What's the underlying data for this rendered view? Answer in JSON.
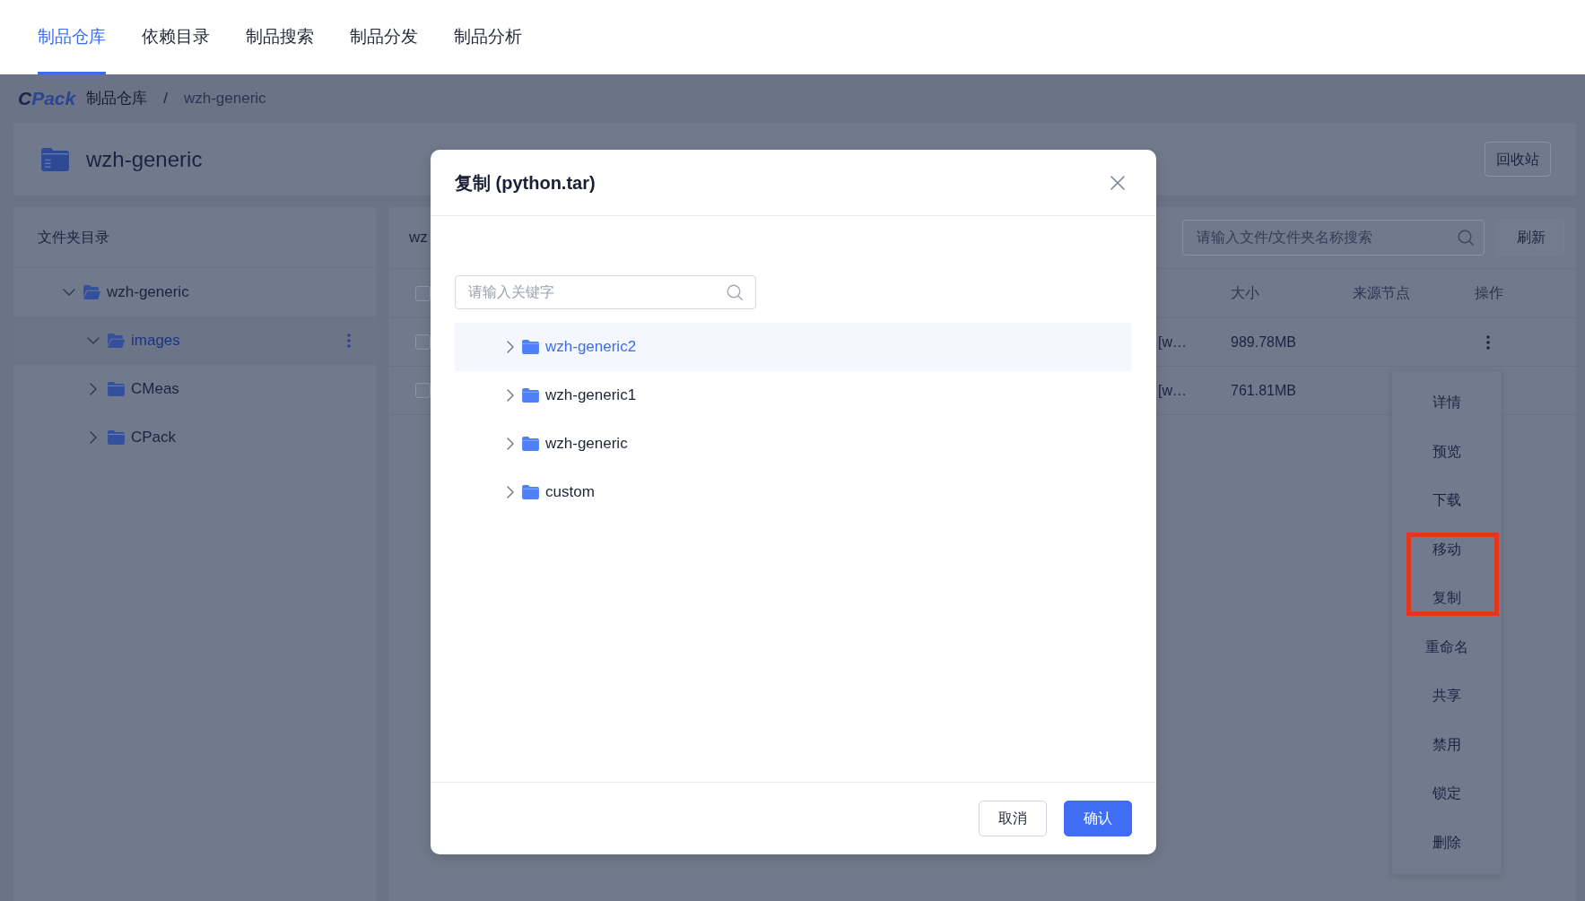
{
  "nav_tabs": [
    {
      "label": "制品仓库",
      "selected": true
    },
    {
      "label": "依赖目录",
      "selected": false
    },
    {
      "label": "制品搜索",
      "selected": false
    },
    {
      "label": "制品分发",
      "selected": false
    },
    {
      "label": "制品分析",
      "selected": false
    }
  ],
  "breadcrumb": {
    "logo": "CPack",
    "separator": "/",
    "items": [
      {
        "label": "制品仓库",
        "current": false
      },
      {
        "label": "wzh-generic",
        "current": true
      }
    ]
  },
  "repo_header": {
    "title": "wzh-generic",
    "recycle_button": "回收站"
  },
  "folder_panel": {
    "title": "文件夹目录",
    "tree": [
      {
        "label": "wzh-generic",
        "expanded": true,
        "selected": false,
        "children": [
          {
            "label": "images",
            "expanded": true,
            "selected": true
          },
          {
            "label": "CMeas",
            "expanded": false,
            "selected": false
          },
          {
            "label": "CPack",
            "expanded": false,
            "selected": false
          }
        ]
      }
    ]
  },
  "file_panel": {
    "path": "wz",
    "search": {
      "placeholder": "请输入文件/文件夹名称搜索"
    },
    "refresh_button": "刷新",
    "table": {
      "select_all": {
        "checked": false
      },
      "columns": [
        {
          "label": "大小"
        },
        {
          "label": "来源节点"
        },
        {
          "label": "操作"
        }
      ],
      "rows": [
        {
          "checked": false,
          "column_2": "[w…",
          "size": "989.78MB",
          "menu_open": true
        },
        {
          "checked": false,
          "column_2": "[w…",
          "size": "761.81MB",
          "menu_open": false
        }
      ]
    },
    "action_menu": {
      "items": [
        {
          "label": "详情",
          "marked": false
        },
        {
          "label": "预览",
          "marked": false
        },
        {
          "label": "下载",
          "marked": false
        },
        {
          "label": "移动",
          "marked": true
        },
        {
          "label": "复制",
          "marked": true
        },
        {
          "label": "重命名",
          "marked": false
        },
        {
          "label": "共享",
          "marked": false
        },
        {
          "label": "禁用",
          "marked": false
        },
        {
          "label": "锁定",
          "marked": false
        },
        {
          "label": "删除",
          "marked": false
        }
      ]
    }
  },
  "dialog": {
    "title": "复制 (python.tar)",
    "search": {
      "placeholder": "请输入关键字"
    },
    "tree": [
      {
        "label": "wzh-generic2",
        "expanded": false,
        "selected": true
      },
      {
        "label": "wzh-generic1",
        "expanded": false,
        "selected": false
      },
      {
        "label": "wzh-generic",
        "expanded": false,
        "selected": false
      },
      {
        "label": "custom",
        "expanded": false,
        "selected": false
      }
    ],
    "buttons": [
      {
        "label": "取消",
        "kind": "secondary"
      },
      {
        "label": "确认",
        "kind": "primary"
      }
    ]
  }
}
